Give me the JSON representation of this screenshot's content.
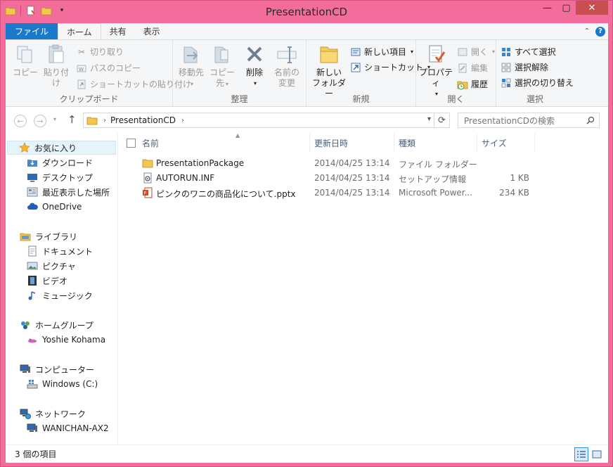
{
  "window": {
    "title": "PresentationCD",
    "controls": {
      "minimize": "—",
      "maximize": "▢",
      "close": "✕"
    }
  },
  "colors": {
    "frame": "#f26d9b",
    "file_tab": "#1979ca",
    "close_button": "#c74f4f",
    "accent": "#1979ca"
  },
  "ribbon": {
    "tabs": [
      "ファイル",
      "ホーム",
      "共有",
      "表示"
    ],
    "active_tab": "ホーム",
    "groups": {
      "clipboard": {
        "label": "クリップボード",
        "copy": "コピー",
        "paste": "貼り付け",
        "cut": "切り取り",
        "copy_path": "パスのコピー",
        "paste_shortcut": "ショートカットの貼り付け"
      },
      "organize": {
        "label": "整理",
        "move_to": "移動先",
        "copy_to": "コピー先",
        "delete": "削除",
        "rename_line1": "名前の",
        "rename_line2": "変更"
      },
      "new": {
        "label": "新規",
        "new_folder_line1": "新しい",
        "new_folder_line2": "フォルダー",
        "new_item": "新しい項目",
        "shortcut": "ショートカット"
      },
      "open": {
        "label": "開く",
        "properties": "プロパティ",
        "open": "開く",
        "edit": "編集",
        "history": "履歴"
      },
      "select": {
        "label": "選択",
        "select_all": "すべて選択",
        "select_none": "選択解除",
        "invert": "選択の切り替え"
      }
    }
  },
  "address": {
    "crumb": "PresentationCD",
    "search_placeholder": "PresentationCDの検索"
  },
  "nav": {
    "favorites": "お気に入り",
    "downloads": "ダウンロード",
    "desktop": "デスクトップ",
    "recent": "最近表示した場所",
    "onedrive": "OneDrive",
    "libraries": "ライブラリ",
    "documents": "ドキュメント",
    "pictures": "ピクチャ",
    "videos": "ビデオ",
    "music": "ミュージック",
    "homegroup": "ホームグループ",
    "homegroup_user": "Yoshie Kohama",
    "computer": "コンピューター",
    "drive": "Windows (C:)",
    "network": "ネットワーク",
    "network_pc": "WANICHAN-AX2"
  },
  "columns": {
    "name": "名前",
    "modified": "更新日時",
    "type": "種類",
    "size": "サイズ"
  },
  "files": [
    {
      "name": "PresentationPackage",
      "modified": "2014/04/25 13:14",
      "type": "ファイル フォルダー",
      "size": "",
      "icon": "folder-icon"
    },
    {
      "name": "AUTORUN.INF",
      "modified": "2014/04/25 13:14",
      "type": "セットアップ情報",
      "size": "1 KB",
      "icon": "setup-file-icon"
    },
    {
      "name": "ピンクのワニの商品化について.pptx",
      "modified": "2014/04/25 13:14",
      "type": "Microsoft Power...",
      "size": "234 KB",
      "icon": "powerpoint-icon"
    }
  ],
  "status": {
    "item_count": "3 個の項目"
  }
}
